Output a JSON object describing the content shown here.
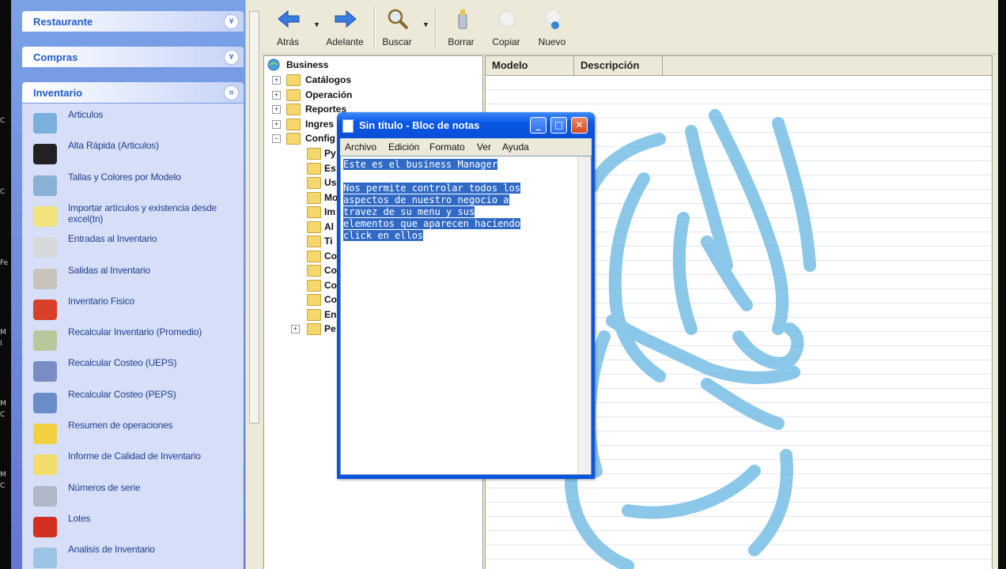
{
  "left_strip": {
    "fragments": [
      "C",
      "C",
      "Fe",
      "M",
      "I",
      "M",
      "C",
      "M",
      "C"
    ]
  },
  "task_pane": {
    "groups": [
      {
        "title": "Restaurante",
        "toggle": "¥"
      },
      {
        "title": "Compras",
        "toggle": "¥"
      },
      {
        "title": "Inventario",
        "toggle": "¤"
      }
    ],
    "items": [
      {
        "label": "Articulos",
        "icon": "articles-icon",
        "color": "#7ab0dc"
      },
      {
        "label": "Alta Rápida (Articulos)",
        "icon": "quick-add-icon",
        "color": "#222222"
      },
      {
        "label": "Tallas y Colores por Modelo",
        "icon": "sizes-colors-icon",
        "color": "#8ab0d4"
      },
      {
        "label": "Importar artículos y existencia desde excel(tn)",
        "icon": "import-excel-icon",
        "color": "#f2e27c"
      },
      {
        "label": "Entradas al Inventario",
        "icon": "inventory-in-icon",
        "color": "#d8d8d8"
      },
      {
        "label": "Salidas al Inventario",
        "icon": "inventory-out-icon",
        "color": "#c8c4bc"
      },
      {
        "label": "Inventario Fisico",
        "icon": "physical-inventory-icon",
        "color": "#d9402a"
      },
      {
        "label": "Recalcular Inventario (Promedio)",
        "icon": "recalc-average-icon",
        "color": "#b8c89c"
      },
      {
        "label": "Recalcular Costeo (UEPS)",
        "icon": "recalc-ueps-icon",
        "color": "#7a8cc4"
      },
      {
        "label": "Recalcular Costeo (PEPS)",
        "icon": "recalc-peps-icon",
        "color": "#6c8cc8"
      },
      {
        "label": "Resumen de operaciones",
        "icon": "operations-summary-icon",
        "color": "#f0d040"
      },
      {
        "label": "Informe de Calidad de Inventario",
        "icon": "quality-report-icon",
        "color": "#f2dc6c"
      },
      {
        "label": "Números de serie",
        "icon": "serial-numbers-icon",
        "color": "#b0b8c8"
      },
      {
        "label": "Lotes",
        "icon": "lots-icon",
        "color": "#d23020"
      },
      {
        "label": "Analisis de Inventario",
        "icon": "inventory-analysis-icon",
        "color": "#9cc4e4"
      }
    ]
  },
  "toolbar": {
    "back": "Atrás",
    "forward": "Adelante",
    "search": "Buscar",
    "delete": "Borrar",
    "copy": "Copiar",
    "new": "Nuevo"
  },
  "tree": {
    "root": "Business",
    "nodes": [
      {
        "label": "Catálogos",
        "expander": "+"
      },
      {
        "label": "Operación",
        "expander": "+"
      },
      {
        "label": "Reportes",
        "expander": "+"
      },
      {
        "label": "Ingres",
        "expander": "+"
      },
      {
        "label": "Config",
        "expander": "−"
      }
    ],
    "children": [
      "Py",
      "Es",
      "Us",
      "Mo",
      "Im",
      "Al",
      "Ti",
      "Co",
      "Co",
      "Co",
      "Co",
      "En",
      "Pe"
    ]
  },
  "grid": {
    "columns": [
      "Modelo",
      "Descripción"
    ]
  },
  "notepad": {
    "title": "Sin título - Bloc de notas",
    "menu": [
      "Archivo",
      "Edición",
      "Formato",
      "Ver",
      "Ayuda"
    ],
    "lines": [
      "Este es el business Manager",
      "",
      "Nos permite controlar todos los",
      "aspectos de nuestro negocio a",
      "travez de su menu y sus",
      "elementos que aparecen haciendo",
      "click en ellos"
    ],
    "minimize": "_",
    "maximize": "□",
    "close": "✕"
  },
  "colors": {
    "task_pane_bg": "#6f8de0",
    "title_bar_blue": "#0a55e0",
    "selection": "#316ac5",
    "logo_blue": "#7fc1e6"
  }
}
